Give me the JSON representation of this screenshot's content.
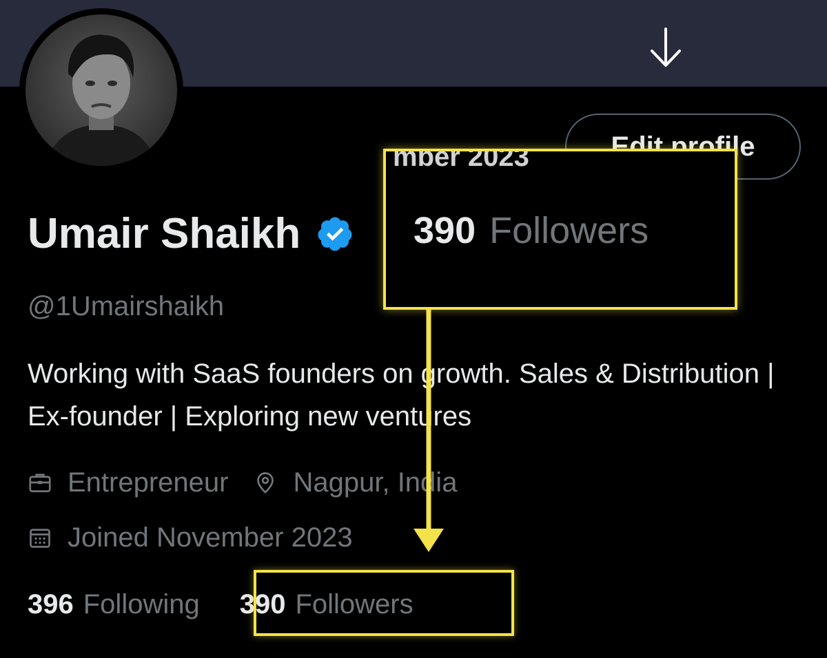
{
  "profile": {
    "name": "Umair Shaikh",
    "handle": "@1Umairshaikh",
    "bio": "Working with SaaS founders on growth. Sales & Distribution | Ex-founder | Exploring new ventures",
    "occupation": "Entrepreneur",
    "location": "Nagpur, India",
    "joined": "Joined November 2023",
    "following_count": "396",
    "following_label": "Following",
    "followers_count": "390",
    "followers_label": "Followers",
    "verified_color": "#1d9bf0"
  },
  "actions": {
    "edit_profile_label": "Edit profile"
  },
  "annotation": {
    "zoom_followers_count": "390",
    "zoom_followers_label": "Followers",
    "zoom_cut_text": "mber 2023",
    "highlight_color": "#f4e24a"
  },
  "icons": {
    "banner_arrow": "arrow-down-icon",
    "verified": "verified-badge-icon",
    "occupation": "briefcase-icon",
    "location": "location-pin-icon",
    "joined": "calendar-icon"
  }
}
